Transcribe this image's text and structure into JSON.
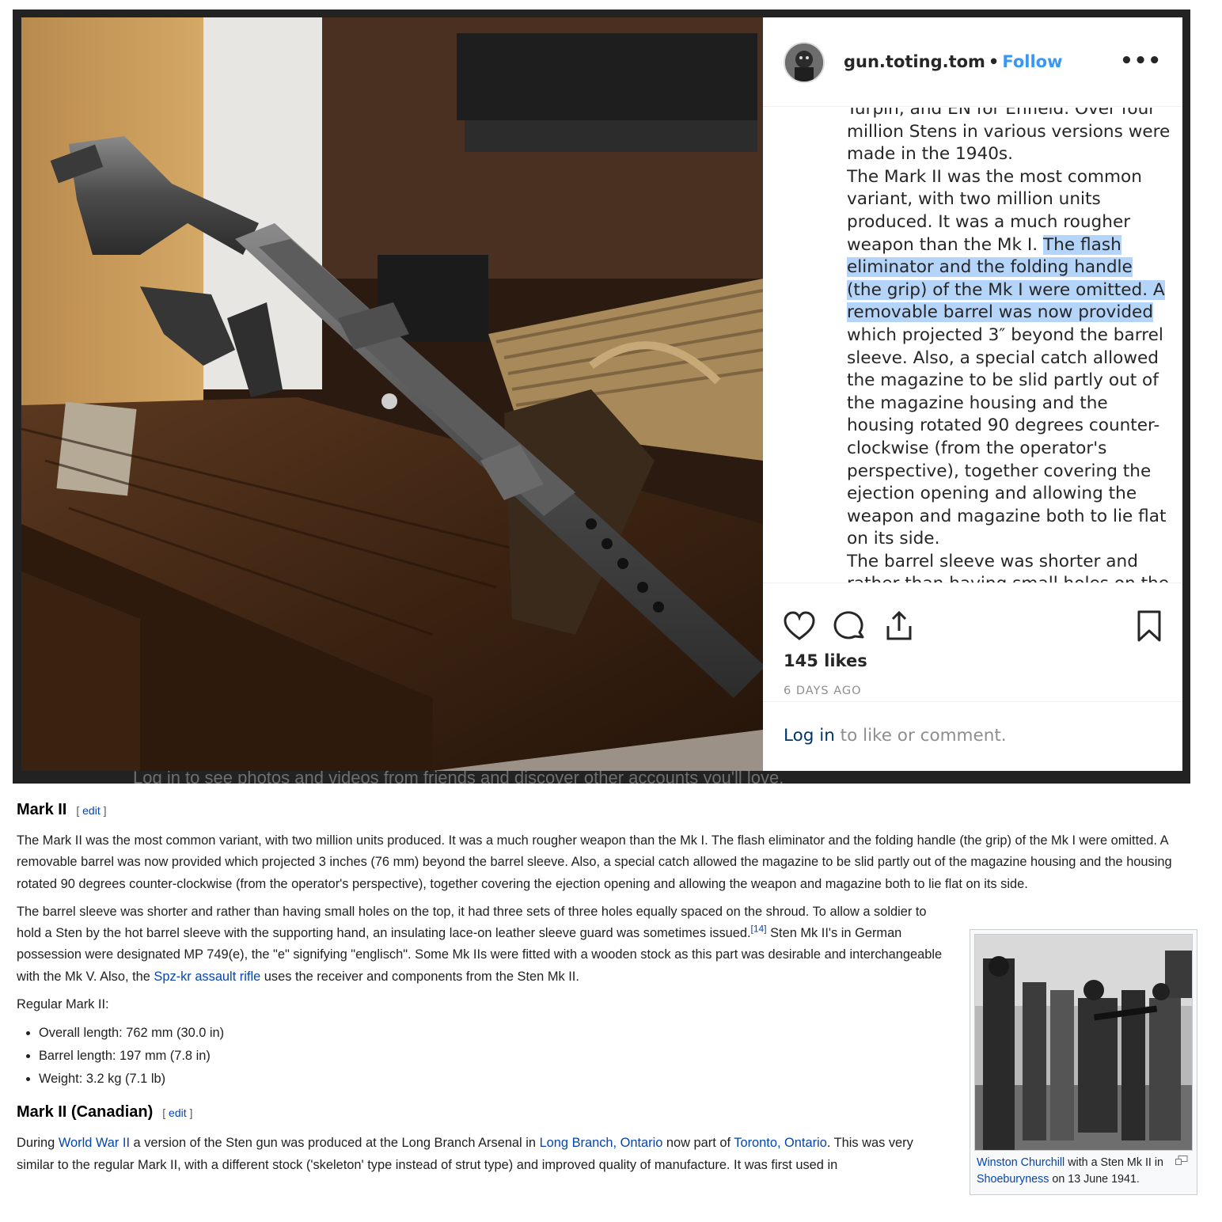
{
  "instagram": {
    "username": "gun.toting.tom",
    "separator": "•",
    "follow_label": "Follow",
    "more_label": "•••",
    "caption_segments": {
      "before": "Turpin, and EN for Enfield. Over four million Stens in various versions were made in the 1940s.\nThe Mark II was the most common variant, with two million units produced. It was a much rougher weapon than the Mk I. ",
      "highlighted": "The flash eliminator and the folding handle (the grip) of the Mk I were omitted. A removable barrel was now provided",
      "after": " which projected 3″ beyond the barrel sleeve. Also, a special catch allowed the magazine to be slid partly out of the magazine housing and the housing rotated 90 degrees counter-clockwise (from the operator's perspective), together covering the ejection opening and allowing the weapon and magazine both to lie flat on its side.\nThe barrel sleeve was shorter and rather than having small holes on the"
    },
    "likes": "145 likes",
    "time_ago": "6 DAYS AGO",
    "login_link": "Log in",
    "login_rest": " to like or comment.",
    "backdrop_text": "Log in to see photos and videos from friends and discover other accounts you'll love.",
    "icons": [
      "heart-icon",
      "comment-icon",
      "share-icon",
      "bookmark-icon"
    ],
    "colors": {
      "follow": "#3897f0",
      "highlight": "#b4d4f9"
    }
  },
  "wiki": {
    "edit_label": "edit",
    "section1": {
      "heading": "Mark II",
      "para1": "The Mark II was the most common variant, with two million units produced. It was a much rougher weapon than the Mk I. The flash eliminator and the folding handle (the grip) of the Mk I were omitted. A removable barrel was now provided which projected 3 inches (76 mm) beyond the barrel sleeve. Also, a special catch allowed the magazine to be slid partly out of the magazine housing and the housing rotated 90 degrees counter-clockwise (from the operator's perspective), together covering the ejection opening and allowing the weapon and magazine both to lie flat on its side.",
      "para2_a": "The barrel sleeve was shorter and rather than having small holes on the top, it had three sets of three holes equally spaced on the shroud. To allow a soldier to hold a Sten by the hot barrel sleeve with the supporting hand, an insulating lace-on leather sleeve guard was sometimes issued.",
      "para2_ref": "[14]",
      "para2_b": " Sten Mk II's in German possession were designated MP 749(e), the \"e\" signifying \"englisch\". Some Mk IIs were fitted with a wooden stock as this part was desirable and interchangeable with the Mk V. Also, the ",
      "para2_link": "Spz-kr assault rifle",
      "para2_c": " uses the receiver and components from the Sten Mk II.",
      "list_title": "Regular Mark II:",
      "specs": [
        "Overall length: 762 mm (30.0 in)",
        "Barrel length: 197 mm (7.8 in)",
        "Weight: 3.2 kg (7.1 lb)"
      ]
    },
    "section2": {
      "heading": "Mark II (Canadian)",
      "p_a": "During ",
      "link1": "World War II",
      "p_b": " a version of the Sten gun was produced at the Long Branch Arsenal in ",
      "link2": "Long Branch, Ontario",
      "p_c": " now part of ",
      "link3": "Toronto, Ontario",
      "p_d": ". This was very similar to the regular Mark II, with a different stock ('skeleton' type instead of strut type) and improved quality of manufacture. It was first used in"
    },
    "thumb": {
      "link1": "Winston Churchill",
      "text1": " with a Sten Mk II in ",
      "link2": "Shoeburyness",
      "text2": " on 13 June 1941."
    },
    "colors": {
      "link": "#0645ad",
      "text": "#202122"
    }
  }
}
